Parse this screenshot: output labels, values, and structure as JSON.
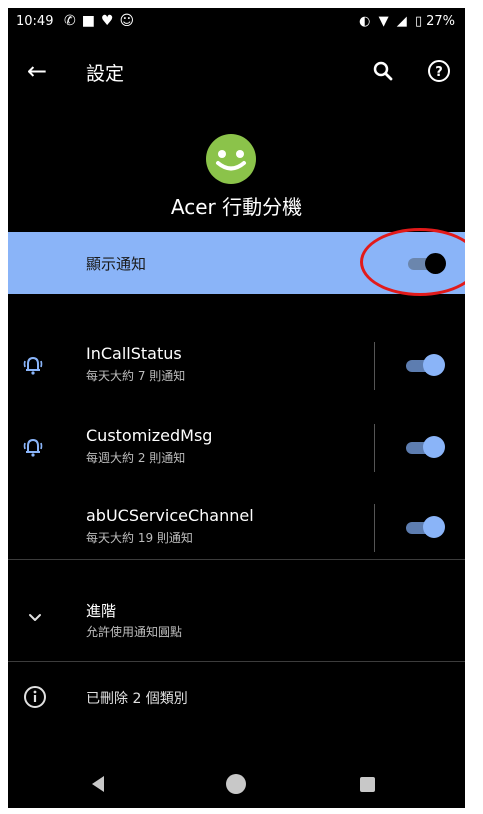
{
  "status_bar": {
    "time": "10:49",
    "battery": "27%"
  },
  "app_bar": {
    "title": "設定"
  },
  "app": {
    "name": "Acer 行動分機",
    "icon": "smiley-face-icon",
    "icon_color": "#8bc34a"
  },
  "show_notifications": {
    "label": "顯示通知",
    "enabled": false
  },
  "channels": [
    {
      "name": "InCallStatus",
      "sub": "每天大約 7 則通知",
      "icon": "bell-icon",
      "enabled": true
    },
    {
      "name": "CustomizedMsg",
      "sub": "每週大約 2 則通知",
      "icon": "bell-icon",
      "enabled": true
    },
    {
      "name": "abUCServiceChannel",
      "sub": "每天大約 19 則通知",
      "icon": null,
      "enabled": true
    }
  ],
  "advanced": {
    "title": "進階",
    "sub": "允許使用通知圓點"
  },
  "deleted": {
    "text": "已刪除 2 個類別"
  },
  "colors": {
    "accent": "#8ab4f8",
    "annotation": "#e21a1a"
  }
}
